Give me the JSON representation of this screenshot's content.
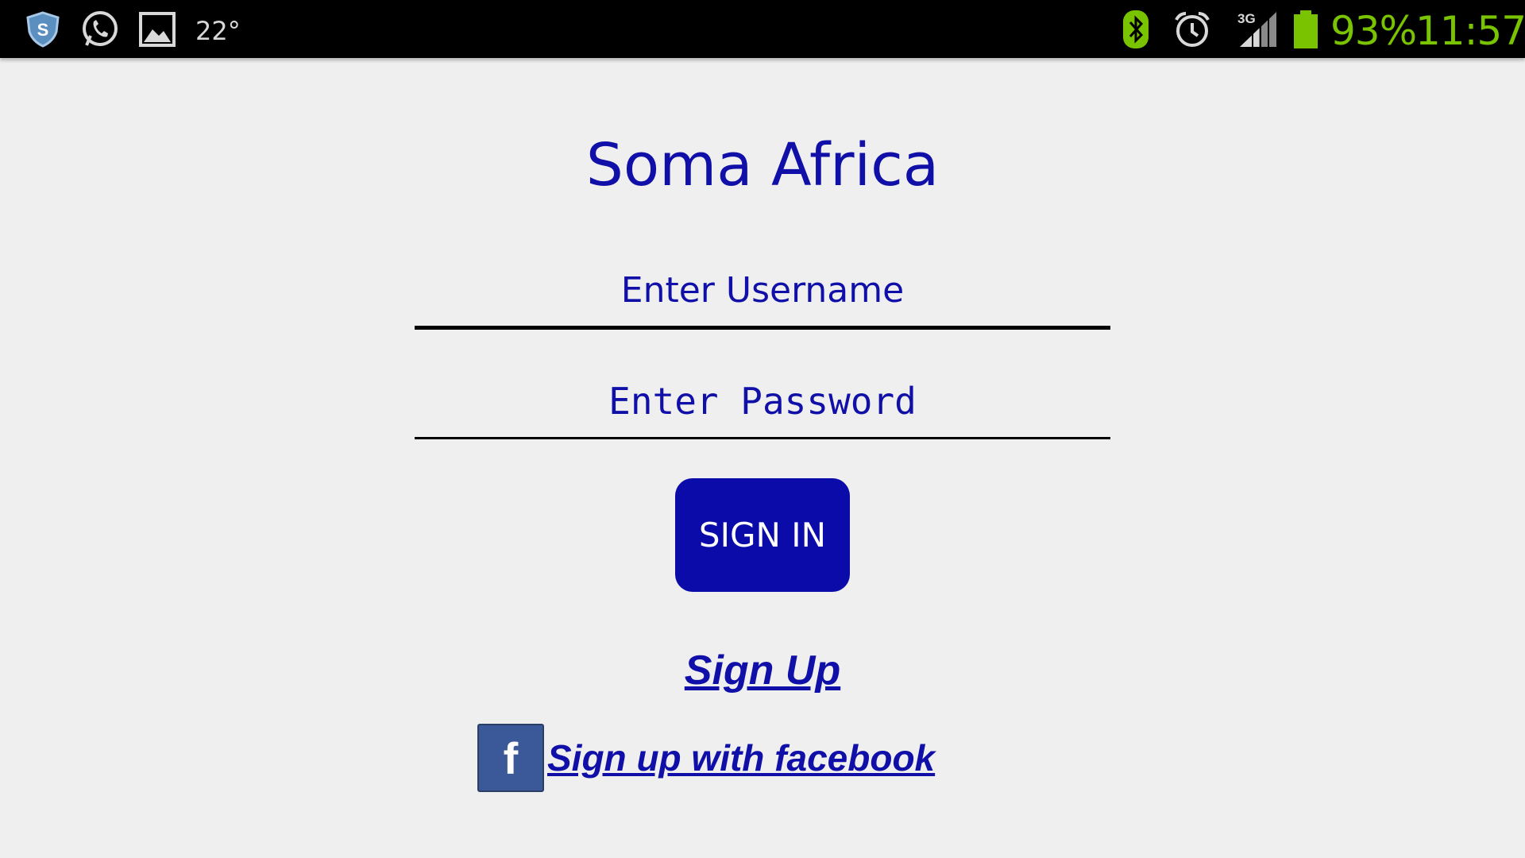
{
  "status_bar": {
    "left_icons": [
      "shield-icon",
      "whatsapp-icon",
      "gallery-icon"
    ],
    "temperature": "22°",
    "right_icons": [
      "bluetooth-icon",
      "alarm-icon",
      "signal-3g-icon",
      "battery-icon"
    ],
    "battery_percent": "93%",
    "time": "11:57",
    "accent_color": "#79c300"
  },
  "app": {
    "title": "Soma Africa",
    "brand_color": "#1010a8"
  },
  "form": {
    "username_placeholder": "Enter Username",
    "password_placeholder": "Enter Password",
    "signin_label": "SIGN IN",
    "signup_label": "Sign Up",
    "facebook_label": "Sign up with facebook",
    "facebook_icon_letter": "f"
  }
}
